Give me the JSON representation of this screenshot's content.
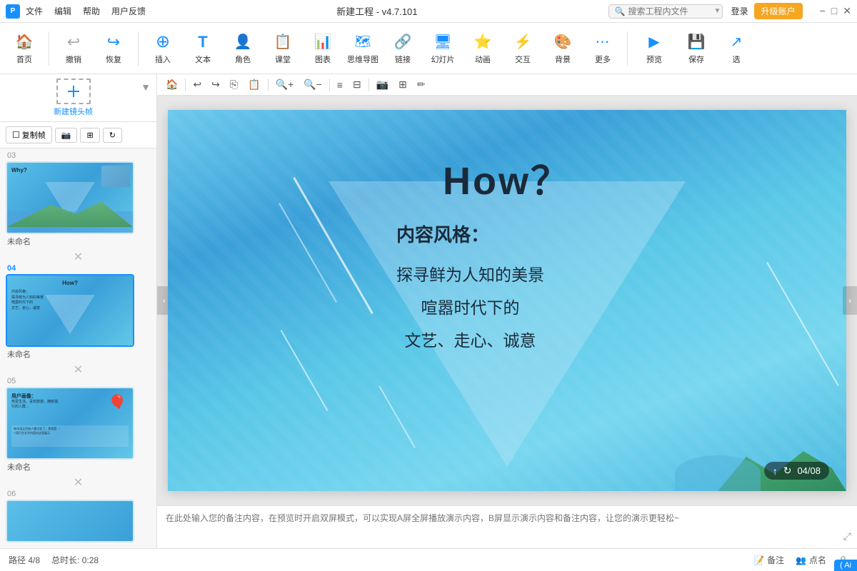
{
  "titlebar": {
    "logo": "P",
    "menu": [
      "文件",
      "编辑",
      "帮助",
      "用户反馈"
    ],
    "title": "新建工程 - v4.7.101",
    "search_placeholder": "搜索工程内文件",
    "btn_login": "登录",
    "btn_upgrade": "升级账户",
    "win_minimize": "−",
    "win_restore": "□",
    "win_close": "✕"
  },
  "toolbar": {
    "items": [
      {
        "id": "home",
        "icon": "🏠",
        "label": "首页"
      },
      {
        "id": "undo",
        "icon": "↩",
        "label": "撤销"
      },
      {
        "id": "redo",
        "icon": "↪",
        "label": "恢复"
      },
      {
        "id": "insert",
        "icon": "⊕",
        "label": "插入"
      },
      {
        "id": "text",
        "icon": "T",
        "label": "文本"
      },
      {
        "id": "role",
        "icon": "👤",
        "label": "角色"
      },
      {
        "id": "class",
        "icon": "📋",
        "label": "课堂"
      },
      {
        "id": "chart",
        "icon": "📊",
        "label": "图表"
      },
      {
        "id": "mindmap",
        "icon": "🗺",
        "label": "思维导图"
      },
      {
        "id": "link",
        "icon": "🔗",
        "label": "链接"
      },
      {
        "id": "slide",
        "icon": "🖼",
        "label": "幻灯片"
      },
      {
        "id": "anim",
        "icon": "✨",
        "label": "动画"
      },
      {
        "id": "interact",
        "icon": "⚡",
        "label": "交互"
      },
      {
        "id": "bg",
        "icon": "🎨",
        "label": "背景"
      },
      {
        "id": "more",
        "icon": "⋯",
        "label": "更多"
      },
      {
        "id": "preview",
        "icon": "▶",
        "label": "预览"
      },
      {
        "id": "save",
        "icon": "💾",
        "label": "保存"
      },
      {
        "id": "select",
        "icon": "↗",
        "label": "选"
      }
    ]
  },
  "sidebar": {
    "new_frame_label": "新建镜头帧",
    "copy_frame_label": "复制帧",
    "tools": [
      "复制帧",
      "📷",
      "⊞",
      "↻"
    ],
    "slides": [
      {
        "num": "03",
        "label": "未命名",
        "type": "slide3"
      },
      {
        "num": "04",
        "label": "未命名",
        "active": true,
        "type": "slide4"
      },
      {
        "num": "05",
        "label": "未命名",
        "type": "slide5"
      },
      {
        "num": "06",
        "label": "",
        "type": "slide6"
      }
    ]
  },
  "canvas": {
    "slide_title": "How？",
    "content_title": "内容风格：",
    "content_lines": [
      "探寻鲜为人知的美景",
      "喧嚣时代下的",
      "文艺、走心、诚意"
    ],
    "page_indicator": "04/08"
  },
  "notes": {
    "placeholder": "在此处输入您的备注内容，在预览时开启双屏模式，可以实现A屏全屏播放演示内容，B屏显示演示内容和备注内容，让您的演示更轻松~"
  },
  "statusbar": {
    "path": "路径 4/8",
    "duration": "总时长: 0:28",
    "notes_btn": "备注",
    "points_btn": "点名",
    "ai_badge": "( Ai"
  }
}
